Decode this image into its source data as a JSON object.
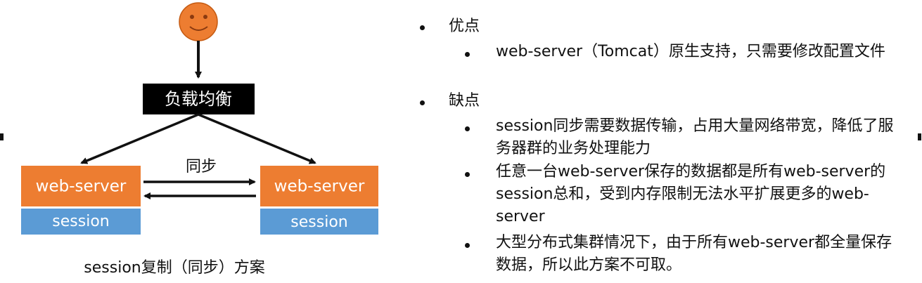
{
  "diagram": {
    "load_balancer_label": "负载均衡",
    "sync_label": "同步",
    "left_server": {
      "top_label": "web-server",
      "bottom_label": "session"
    },
    "right_server": {
      "top_label": "web-server",
      "bottom_label": "session"
    },
    "caption": "session复制（同步）方案",
    "colors": {
      "server": "#ED7D31",
      "session": "#5B9BD5",
      "balancer": "#000000",
      "client_face": "#ED7D31"
    },
    "client_icon": "smiley-face-icon"
  },
  "notes": {
    "pros_heading": "优点",
    "pros_items": [
      "web-server（Tomcat）原生支持，只需要修改配置文件"
    ],
    "cons_heading": "缺点",
    "cons_items": [
      "session同步需要数据传输，占用大量网络带宽，降低了服务器群的业务处理能力",
      "任意一台web-server保存的数据都是所有web-server的session总和，受到内存限制无法水平扩展更多的web-server",
      "大型分布式集群情况下，由于所有web-server都全量保存数据，所以此方案不可取。"
    ]
  }
}
